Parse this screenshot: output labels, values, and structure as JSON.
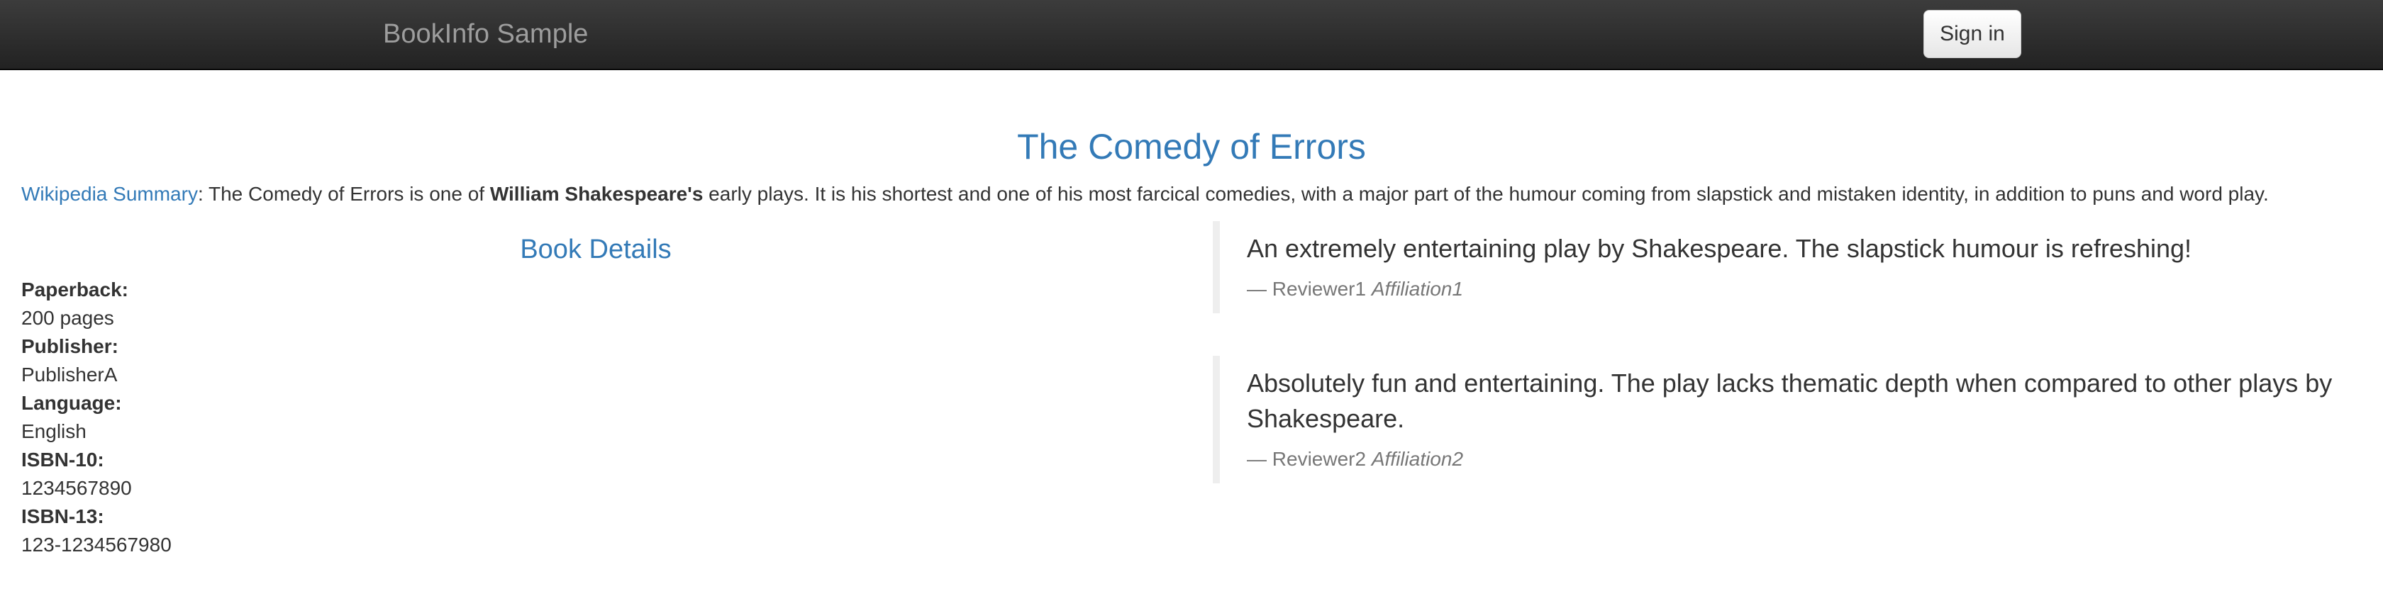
{
  "navbar": {
    "brand": "BookInfo Sample",
    "signin_label": "Sign in"
  },
  "book": {
    "title": "The Comedy of Errors",
    "summary": {
      "link_text": "Wikipedia Summary",
      "text_before_author": ": The Comedy of Errors is one of ",
      "author_bold": "William Shakespeare's",
      "text_after_author": " early plays. It is his shortest and one of his most farcical comedies, with a major part of the humour coming from slapstick and mistaken identity, in addition to puns and word play."
    }
  },
  "details": {
    "heading": "Book Details",
    "items": [
      {
        "label": "Paperback:",
        "value": "200 pages"
      },
      {
        "label": "Publisher:",
        "value": "PublisherA"
      },
      {
        "label": "Language:",
        "value": "English"
      },
      {
        "label": "ISBN-10:",
        "value": "1234567890"
      },
      {
        "label": "ISBN-13:",
        "value": "123-1234567980"
      }
    ]
  },
  "reviews": [
    {
      "text": "An extremely entertaining play by Shakespeare. The slapstick humour is refreshing!",
      "reviewer": "— Reviewer1",
      "affiliation": "Affiliation1"
    },
    {
      "text": "Absolutely fun and entertaining. The play lacks thematic depth when compared to other plays by Shakespeare.",
      "reviewer": "— Reviewer2",
      "affiliation": "Affiliation2"
    }
  ]
}
